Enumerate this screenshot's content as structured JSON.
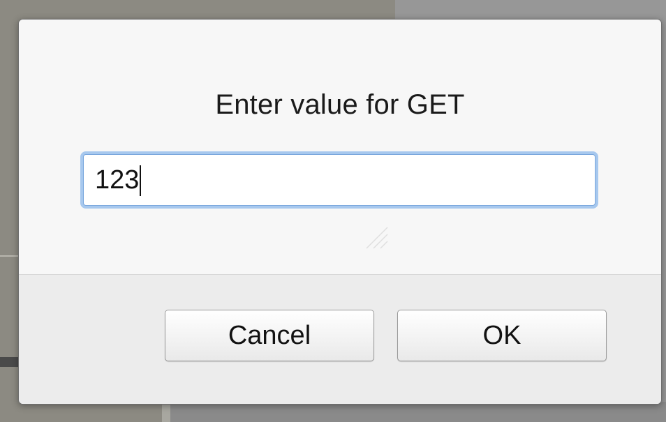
{
  "dialog": {
    "title": "Enter value for GET",
    "input": {
      "value": "123",
      "placeholder": ""
    },
    "buttons": {
      "cancel_label": "Cancel",
      "ok_label": "OK"
    }
  },
  "colors": {
    "focus_ring": "#a7c8ee",
    "dialog_bg": "#f7f7f7",
    "footer_bg": "#ececec"
  }
}
